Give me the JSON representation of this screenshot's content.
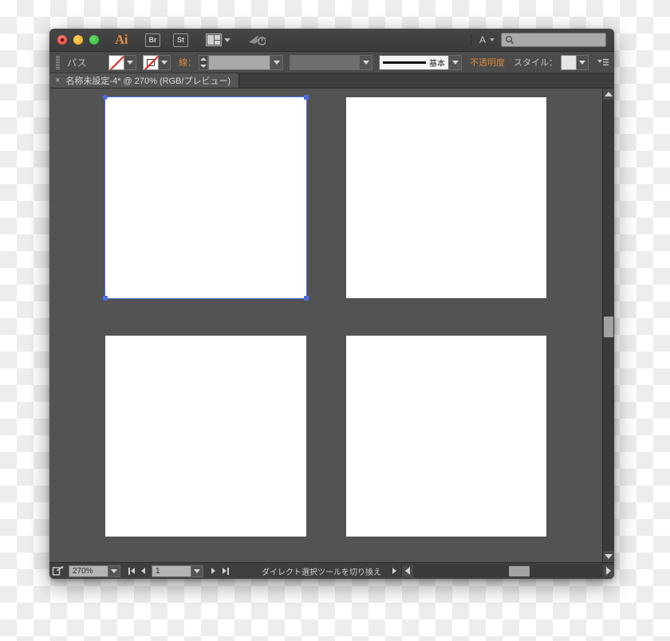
{
  "window": {
    "app_name": "Ai",
    "traffic_lights": [
      "close",
      "minimize",
      "maximize"
    ]
  },
  "title_bar": {
    "bridge_label": "Br",
    "stock_label": "St",
    "arrange_icon": "arrange-documents-icon",
    "cc_icon": "creative-cloud-icon",
    "workspace_letter": "A",
    "search_placeholder": "",
    "search_value": ""
  },
  "control_bar": {
    "object_type": "パス",
    "fill_label": "fill-swatch",
    "stroke_label": "stroke-swatch",
    "stroke_text": "線：",
    "stroke_weight_value": "",
    "variable_width_value": "",
    "brush_label": "基本",
    "opacity_label": "不透明度",
    "style_label": "スタイル：",
    "panel_menu_icon": "panel-menu-icon"
  },
  "tab_bar": {
    "close_glyph": "×",
    "document_title": "名称未設定-4* @ 270% (RGB/プレビュー)"
  },
  "canvas": {
    "artboards": [
      {
        "name": "artboard-1",
        "selected": true
      },
      {
        "name": "artboard-2",
        "selected": false
      },
      {
        "name": "artboard-3",
        "selected": false
      },
      {
        "name": "artboard-4",
        "selected": false
      }
    ],
    "selection_color": "#4a6ee0",
    "canvas_color": "#535353",
    "artboard_color": "#ffffff"
  },
  "status_bar": {
    "export_icon": "export-share-icon",
    "zoom_value": "270%",
    "page_value": "1",
    "status_message": "ダイレクト選択ツールを切り換え"
  }
}
